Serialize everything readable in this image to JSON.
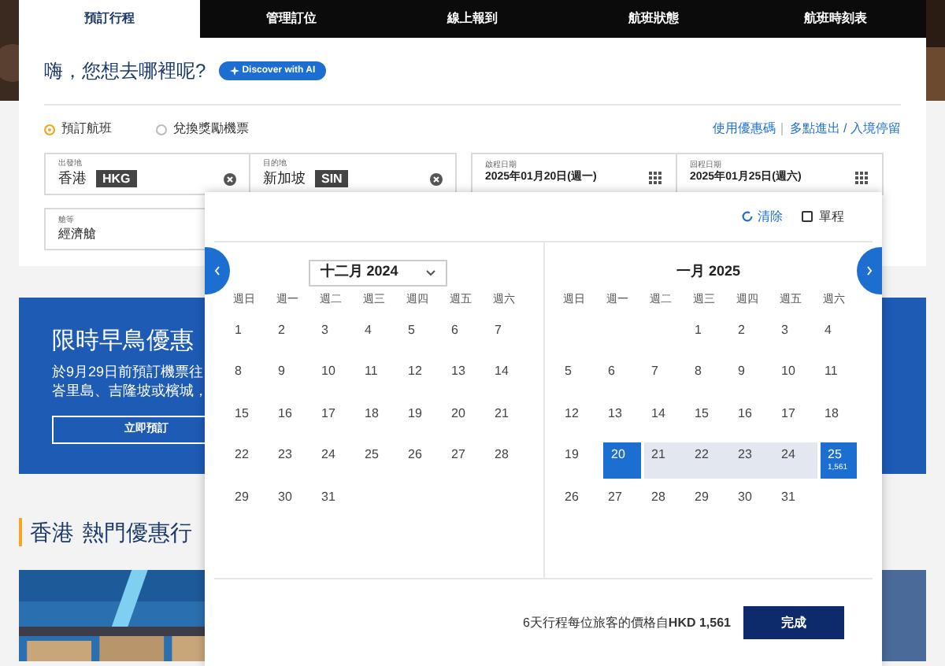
{
  "tabs": [
    {
      "label": "預訂行程",
      "selected": true
    },
    {
      "label": "管理訂位",
      "selected": false
    },
    {
      "label": "線上報到",
      "selected": false
    },
    {
      "label": "航班狀態",
      "selected": false
    },
    {
      "label": "航班時刻表",
      "selected": false
    }
  ],
  "greeting": "嗨，您想去哪裡呢?",
  "ai_button": "Discover with AI",
  "trip_types": [
    {
      "label": "預訂航班",
      "selected": true
    },
    {
      "label": "兌換獎勵機票",
      "selected": false
    }
  ],
  "links": [
    "使用優惠碼",
    "多點進出 / 入境停留"
  ],
  "origin": {
    "label": "出發地",
    "city": "香港",
    "code": "HKG"
  },
  "destination": {
    "label": "目的地",
    "city": "新加坡",
    "code": "SIN"
  },
  "depart": {
    "label": "啟程日期",
    "value": "2025年01月20日(週一)"
  },
  "return": {
    "label": "回程日期",
    "value": "2025年01月25日(週六)"
  },
  "cabin": {
    "label": "艙等",
    "value": "經濟艙"
  },
  "promo": {
    "title": "限時早鳥優惠",
    "lines": [
      "於9月29日前預訂機票往",
      "峇里島、吉隆坡或檳城，"
    ],
    "button": "立即預訂"
  },
  "section": {
    "city": "香港",
    "title": "熱門優惠行"
  },
  "bottom_image": {
    "kind": "picture"
  },
  "calendar": {
    "clear": "清除",
    "one_way": {
      "label": "單程",
      "checked": false
    },
    "months": [
      {
        "title": "十二月 2024",
        "kind": "dropdown",
        "weekdays": [
          "週日",
          "週一",
          "週二",
          "週三",
          "週四",
          "週五",
          "週六"
        ],
        "weeks": [
          [
            {
              "kind": "day",
              "d": "1",
              "selected": false,
              "in_range": false
            },
            {
              "kind": "day",
              "d": "2",
              "selected": false,
              "in_range": false
            },
            {
              "kind": "day",
              "d": "3",
              "selected": false,
              "in_range": false
            },
            {
              "kind": "day",
              "d": "4",
              "selected": false,
              "in_range": false
            },
            {
              "kind": "day",
              "d": "5",
              "selected": false,
              "in_range": false
            },
            {
              "kind": "day",
              "d": "6",
              "selected": false,
              "in_range": false
            },
            {
              "kind": "day",
              "d": "7",
              "selected": false,
              "in_range": false
            }
          ],
          [
            {
              "kind": "day",
              "d": "8",
              "selected": false,
              "in_range": false
            },
            {
              "kind": "day",
              "d": "9",
              "selected": false,
              "in_range": false
            },
            {
              "kind": "day",
              "d": "10",
              "selected": false,
              "in_range": false
            },
            {
              "kind": "day",
              "d": "11",
              "selected": false,
              "in_range": false
            },
            {
              "kind": "day",
              "d": "12",
              "selected": false,
              "in_range": false
            },
            {
              "kind": "day",
              "d": "13",
              "selected": false,
              "in_range": false
            },
            {
              "kind": "day",
              "d": "14",
              "selected": false,
              "in_range": false
            }
          ],
          [
            {
              "kind": "day",
              "d": "15",
              "selected": false,
              "in_range": false
            },
            {
              "kind": "day",
              "d": "16",
              "selected": false,
              "in_range": false
            },
            {
              "kind": "day",
              "d": "17",
              "selected": false,
              "in_range": false
            },
            {
              "kind": "day",
              "d": "18",
              "selected": false,
              "in_range": false
            },
            {
              "kind": "day",
              "d": "19",
              "selected": false,
              "in_range": false
            },
            {
              "kind": "day",
              "d": "20",
              "selected": false,
              "in_range": false
            },
            {
              "kind": "day",
              "d": "21",
              "selected": false,
              "in_range": false
            }
          ],
          [
            {
              "kind": "day",
              "d": "22",
              "selected": false,
              "in_range": false
            },
            {
              "kind": "day",
              "d": "23",
              "selected": false,
              "in_range": false
            },
            {
              "kind": "day",
              "d": "24",
              "selected": false,
              "in_range": false
            },
            {
              "kind": "day",
              "d": "25",
              "selected": false,
              "in_range": false
            },
            {
              "kind": "day",
              "d": "26",
              "selected": false,
              "in_range": false
            },
            {
              "kind": "day",
              "d": "27",
              "selected": false,
              "in_range": false
            },
            {
              "kind": "day",
              "d": "28",
              "selected": false,
              "in_range": false
            }
          ],
          [
            {
              "kind": "day",
              "d": "29",
              "selected": false,
              "in_range": false
            },
            {
              "kind": "day",
              "d": "30",
              "selected": false,
              "in_range": false
            },
            {
              "kind": "day",
              "d": "31",
              "selected": false,
              "in_range": false
            }
          ]
        ]
      },
      {
        "title": "一月 2025",
        "kind": "label",
        "weekdays": [
          "週日",
          "週一",
          "週二",
          "週三",
          "週四",
          "週五",
          "週六"
        ],
        "weeks": [
          [
            {
              "kind": "blank"
            },
            {
              "kind": "blank"
            },
            {
              "kind": "blank"
            },
            {
              "kind": "day",
              "d": "1",
              "selected": false,
              "in_range": false
            },
            {
              "kind": "day",
              "d": "2",
              "selected": false,
              "in_range": false
            },
            {
              "kind": "day",
              "d": "3",
              "selected": false,
              "in_range": false
            },
            {
              "kind": "day",
              "d": "4",
              "selected": false,
              "in_range": false
            }
          ],
          [
            {
              "kind": "day",
              "d": "5",
              "selected": false,
              "in_range": false
            },
            {
              "kind": "day",
              "d": "6",
              "selected": false,
              "in_range": false
            },
            {
              "kind": "day",
              "d": "7",
              "selected": false,
              "in_range": false
            },
            {
              "kind": "day",
              "d": "8",
              "selected": false,
              "in_range": false
            },
            {
              "kind": "day",
              "d": "9",
              "selected": false,
              "in_range": false
            },
            {
              "kind": "day",
              "d": "10",
              "selected": false,
              "in_range": false
            },
            {
              "kind": "day",
              "d": "11",
              "selected": false,
              "in_range": false
            }
          ],
          [
            {
              "kind": "day",
              "d": "12",
              "selected": false,
              "in_range": false
            },
            {
              "kind": "day",
              "d": "13",
              "selected": false,
              "in_range": false
            },
            {
              "kind": "day",
              "d": "14",
              "selected": false,
              "in_range": false
            },
            {
              "kind": "day",
              "d": "15",
              "selected": false,
              "in_range": false
            },
            {
              "kind": "day",
              "d": "16",
              "selected": false,
              "in_range": false
            },
            {
              "kind": "day",
              "d": "17",
              "selected": false,
              "in_range": false
            },
            {
              "kind": "day",
              "d": "18",
              "selected": false,
              "in_range": false
            }
          ],
          [
            {
              "kind": "day",
              "d": "19",
              "selected": false,
              "in_range": false
            },
            {
              "kind": "day",
              "d": "20",
              "selected": true,
              "in_range": false
            },
            {
              "kind": "day",
              "d": "21",
              "selected": false,
              "in_range": true
            },
            {
              "kind": "day",
              "d": "22",
              "selected": false,
              "in_range": true
            },
            {
              "kind": "day",
              "d": "23",
              "selected": false,
              "in_range": true
            },
            {
              "kind": "day",
              "d": "24",
              "selected": false,
              "in_range": true
            },
            {
              "kind": "day",
              "d": "25",
              "selected": true,
              "in_range": false,
              "price": "1,561"
            }
          ],
          [
            {
              "kind": "day",
              "d": "26",
              "selected": false,
              "in_range": false
            },
            {
              "kind": "day",
              "d": "27",
              "selected": false,
              "in_range": false
            },
            {
              "kind": "day",
              "d": "28",
              "selected": false,
              "in_range": false
            },
            {
              "kind": "day",
              "d": "29",
              "selected": false,
              "in_range": false
            },
            {
              "kind": "day",
              "d": "30",
              "selected": false,
              "in_range": false
            },
            {
              "kind": "day",
              "d": "31",
              "selected": false,
              "in_range": false
            }
          ]
        ]
      }
    ],
    "summary": "6天行程每位旅客的價格自**HKD 1,561**",
    "done": "完成"
  }
}
